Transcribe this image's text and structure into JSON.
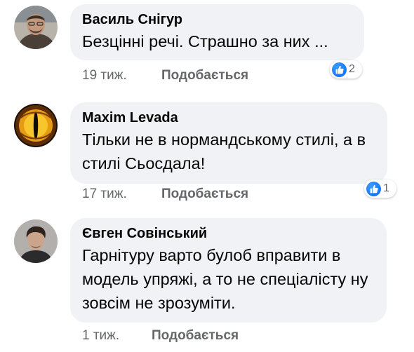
{
  "comments": [
    {
      "author": "Василь Снігур",
      "text": "Безцінні речі. Страшно за них ...",
      "time": "19 тиж.",
      "like_label": "Подобається",
      "reaction_count": "2",
      "reaction_icon": "thumbs-up-icon",
      "avatar": "profile-photo"
    },
    {
      "author": "Maxim Levada",
      "text": "Тільки не в нормандському стилі, а в стилі Сьосдала!",
      "time": "17 тиж.",
      "like_label": "Подобається",
      "reaction_count": "1",
      "reaction_icon": "thumbs-up-icon",
      "avatar": "dragon-eye-image"
    },
    {
      "author": "Євген Совінський",
      "text": "Гарнітуру варто булоб вправити в модель упряжі, а то не спеціалісту ну зовсім не зрозуміти.",
      "time": "1 тиж.",
      "like_label": "Подобається",
      "avatar": "profile-photo"
    }
  ],
  "colors": {
    "bubble": "#f0f2f5",
    "meta": "#65676b",
    "like_blue": "#0866ff"
  }
}
